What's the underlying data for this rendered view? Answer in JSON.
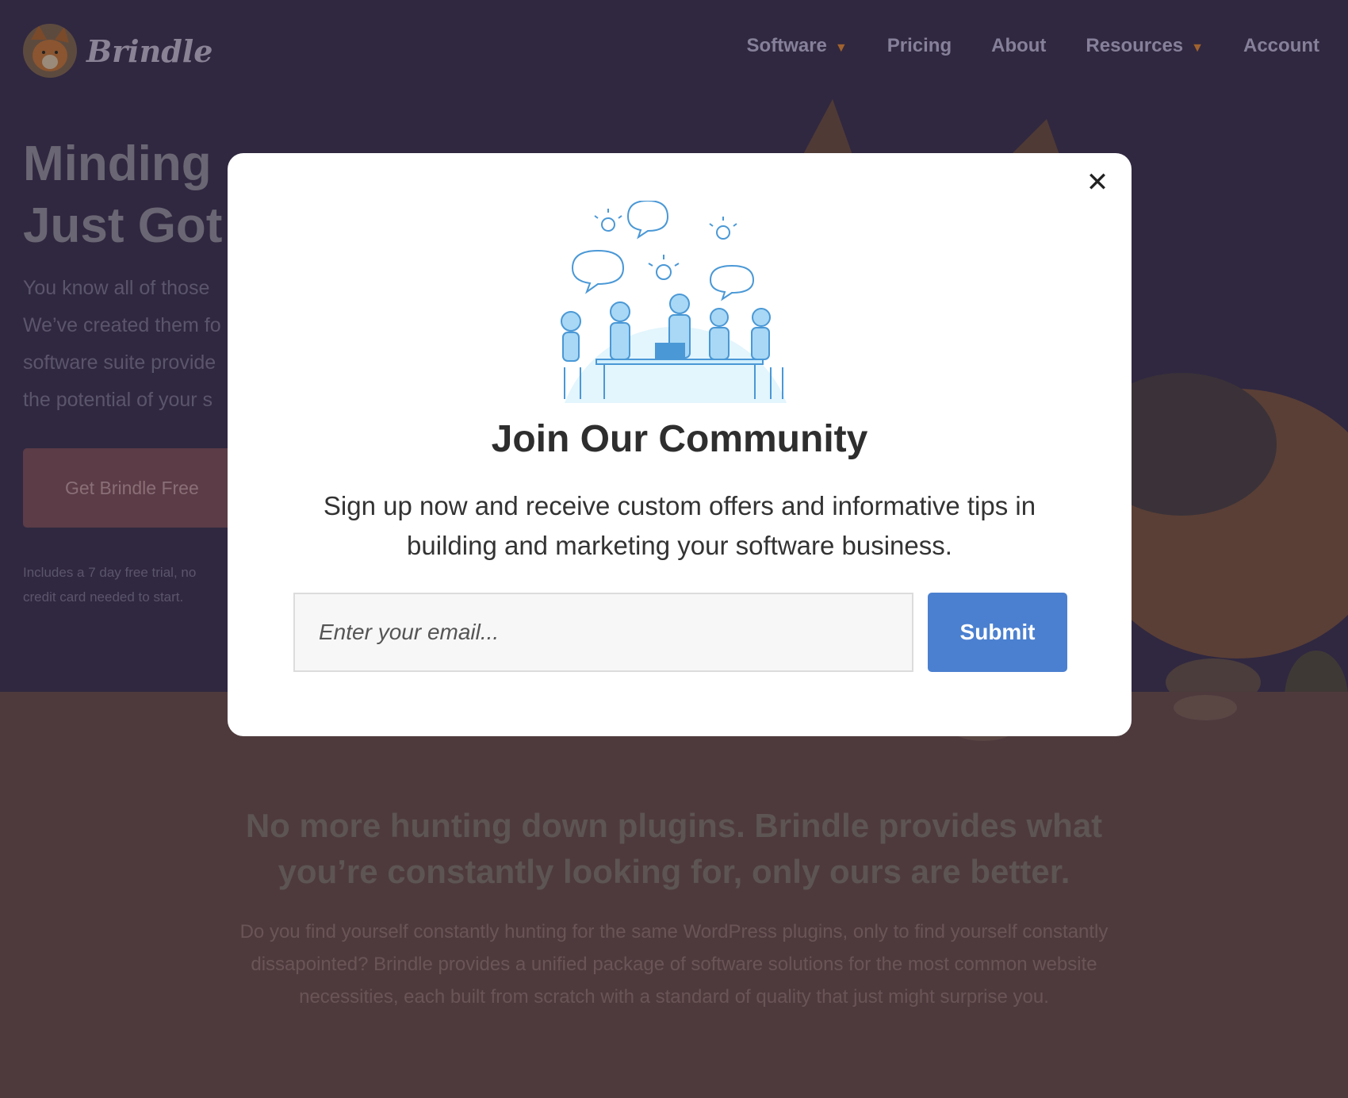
{
  "header": {
    "brand_name": "Brindle",
    "nav": [
      {
        "label": "Software",
        "has_dropdown": true
      },
      {
        "label": "Pricing",
        "has_dropdown": false
      },
      {
        "label": "About",
        "has_dropdown": false
      },
      {
        "label": "Resources",
        "has_dropdown": true
      },
      {
        "label": "Account",
        "has_dropdown": false
      }
    ],
    "dropdown_caret": "▼"
  },
  "hero": {
    "title_line1": "Minding",
    "title_line2": "Just Got",
    "text_lines": [
      "You know all of those",
      "We’ve created them fo",
      "software suite provide",
      "the potential of your s"
    ],
    "cta_label": "Get Brindle Free",
    "note_line1": "Includes a 7 day free trial, no",
    "note_line2": "credit card needed to start."
  },
  "lower": {
    "title_line1": "No more hunting down plugins. Brindle provides what",
    "title_line2": "you’re constantly looking for, only ours are better.",
    "text_line1": "Do you find yourself constantly hunting for the same WordPress plugins, only to find yourself constantly",
    "text_line2": "dissapointed? Brindle provides a unified package of software solutions for the most common website",
    "text_line3": "necessities, each built from scratch with a standard of quality that just might surprise you."
  },
  "modal": {
    "close_glyph": "✕",
    "title": "Join Our Community",
    "text_line1": "Sign up now and receive custom offers and informative tips in",
    "text_line2": "building and marketing your software business.",
    "email_placeholder": "Enter your email...",
    "submit_label": "Submit"
  },
  "colors": {
    "overlay_top": "#302840",
    "overlay_bottom": "#4e3a3d",
    "submit": "#4b80d0",
    "illustration_bg": "#e3f5fd",
    "illustration_stroke": "#4a98d6"
  },
  "icons": {
    "logo": "corgi-logo-icon",
    "close": "close-icon",
    "dropdown": "caret-down-icon"
  }
}
